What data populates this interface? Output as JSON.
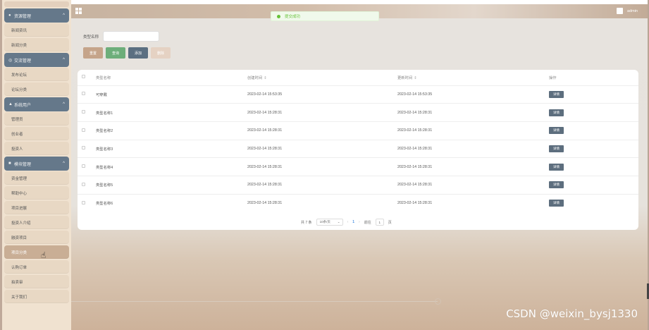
{
  "sidebar": {
    "groups": [
      {
        "label": "资源管理",
        "icon": "●",
        "items": [
          "新闻资讯",
          "新闻分类"
        ]
      },
      {
        "label": "交流管理",
        "icon": "◎",
        "items": [
          "发布论坛",
          "论坛分类"
        ]
      },
      {
        "label": "系统用户",
        "icon": "▲",
        "items": [
          "管理员",
          "创业者",
          "投资人"
        ]
      },
      {
        "label": "模块管理",
        "icon": "■",
        "items": [
          "资金管理",
          "帮助中心",
          "项目进展",
          "投资人介绍",
          "融资项目",
          "项目分类",
          "认购订单",
          "拍卖审",
          "关于我们"
        ]
      }
    ],
    "active_item": "项目分类"
  },
  "header": {
    "user": "admin"
  },
  "toast": {
    "message": "提交成功"
  },
  "search": {
    "label": "类型名称",
    "value": "",
    "placeholder": ""
  },
  "buttons": {
    "reset": "重置",
    "query": "查询",
    "add": "添加",
    "delete": "删除"
  },
  "table": {
    "headers": {
      "name": "类型名称",
      "created": "创建时间",
      "updated": "更新时间",
      "action": "操作"
    },
    "rows": [
      {
        "name": "可穿戴",
        "created": "2023-02-14 15:53:35",
        "updated": "2023-02-14 15:53:35",
        "action": "详情"
      },
      {
        "name": "类型名称1",
        "created": "2023-02-14 15:28:31",
        "updated": "2023-02-14 15:28:31",
        "action": "详情"
      },
      {
        "name": "类型名称2",
        "created": "2023-02-14 15:28:31",
        "updated": "2023-02-14 15:28:31",
        "action": "详情"
      },
      {
        "name": "类型名称3",
        "created": "2023-02-14 15:28:31",
        "updated": "2023-02-14 15:28:31",
        "action": "详情"
      },
      {
        "name": "类型名称4",
        "created": "2023-02-14 15:28:31",
        "updated": "2023-02-14 15:28:31",
        "action": "详情"
      },
      {
        "name": "类型名称5",
        "created": "2023-02-14 15:28:31",
        "updated": "2023-02-14 15:28:31",
        "action": "详情"
      },
      {
        "name": "类型名称6",
        "created": "2023-02-14 15:28:31",
        "updated": "2023-02-14 15:28:31",
        "action": "详情"
      }
    ]
  },
  "pagination": {
    "total": "共 7 条",
    "page_size": "10条/页",
    "current_page": "1",
    "goto_label": "前往",
    "goto_value": "1",
    "page_suffix": "页"
  },
  "watermark": "CSDN @weixin_bysj1330",
  "colors": {
    "sidebar_group": "#65788a",
    "sidebar_item": "#e8d8c4",
    "active_item": "#c9ae95",
    "success": "#67c23a"
  }
}
